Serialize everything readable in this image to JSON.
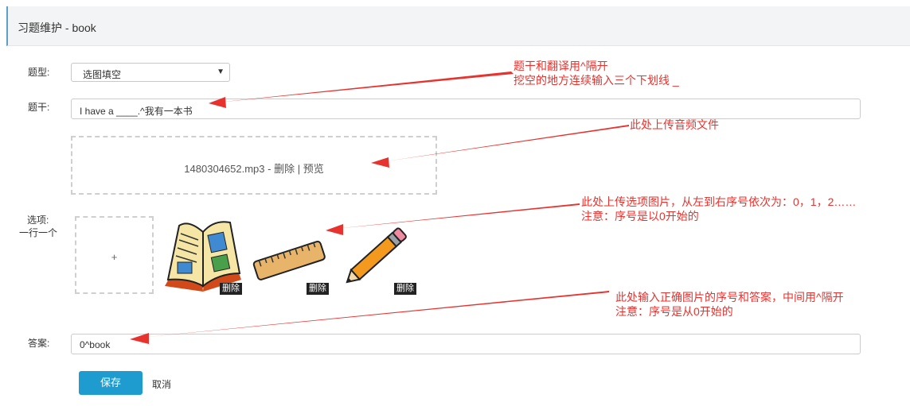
{
  "header": {
    "title": "习题维护 - book"
  },
  "form": {
    "type_label": "题型:",
    "type_value": "选图填空",
    "stem_label": "题干:",
    "stem_value": "I have a ____.^我有一本书",
    "audio": {
      "filename": "1480304652.mp3",
      "sep1": " - ",
      "delete": "删除",
      "sep2": " | ",
      "preview": "预览"
    },
    "options_label_1": "选项:",
    "options_label_2": "一行一个",
    "upload_plus": "+",
    "images": [
      {
        "name": "book-image",
        "delete": "删除"
      },
      {
        "name": "ruler-image",
        "delete": "删除"
      },
      {
        "name": "pencil-image",
        "delete": "删除"
      }
    ],
    "answer_label": "答案:",
    "answer_value": "0^book",
    "save": "保存",
    "cancel": "取消"
  },
  "annotations": {
    "note1_line1": "题干和翻译用^隔开",
    "note1_line2": "挖空的地方连续输入三个下划线 _",
    "note2": "此处上传音频文件",
    "note3_line1": "此处上传选项图片，从左到右序号依次为：0，1，2……",
    "note3_line2": "注意：序号是以0开始的",
    "note4_line1": "此处输入正确图片的序号和答案，中间用^隔开",
    "note4_line2": "注意：序号是从0开始的"
  },
  "colors": {
    "accent": "#1e9ccf",
    "annotation": "#e8322e"
  }
}
